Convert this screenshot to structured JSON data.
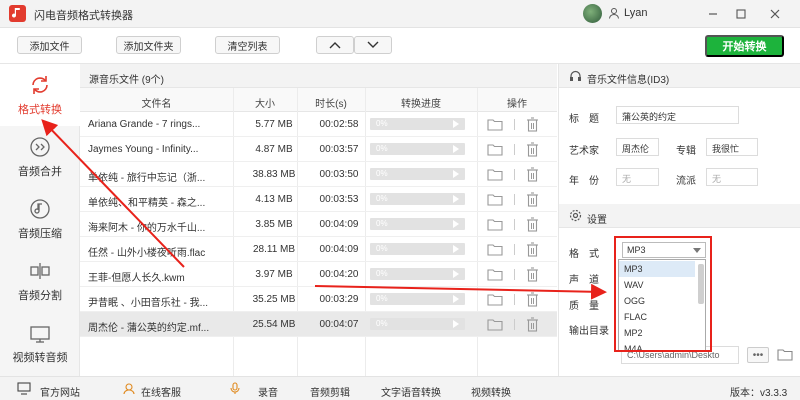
{
  "window": {
    "title": "闪电音频格式转换器",
    "user": "Lyan"
  },
  "toolbar": {
    "add_file": "添加文件",
    "add_folder": "添加文件夹",
    "clear_list": "清空列表",
    "start": "开始转换"
  },
  "sidebar": {
    "items": [
      {
        "label": "格式转换",
        "icon": "refresh-icon",
        "active": true
      },
      {
        "label": "音频合并",
        "icon": "merge-icon"
      },
      {
        "label": "音频压缩",
        "icon": "compress-icon"
      },
      {
        "label": "音频分割",
        "icon": "split-icon"
      },
      {
        "label": "视频转音频",
        "icon": "video-icon"
      }
    ]
  },
  "list": {
    "title": "源音乐文件 (9个)",
    "columns": {
      "name": "文件名",
      "size": "大小",
      "duration": "时长(s)",
      "progress": "转换进度",
      "action": "操作"
    },
    "progress_label": "0%",
    "rows": [
      {
        "name": "Ariana Grande - 7 rings...",
        "size": "5.77 MB",
        "duration": "00:02:58"
      },
      {
        "name": "Jaymes Young - Infinity...",
        "size": "4.87 MB",
        "duration": "00:03:57"
      },
      {
        "name": "单依纯 - 旅行中忘记（浙...",
        "size": "38.83 MB",
        "duration": "00:03:50"
      },
      {
        "name": "单依纯、和平精英 - 森之...",
        "size": "4.13 MB",
        "duration": "00:03:53"
      },
      {
        "name": "海来阿木 - 你的万水千山...",
        "size": "3.85 MB",
        "duration": "00:04:09"
      },
      {
        "name": "任然 - 山外小楼夜听雨.flac",
        "size": "28.11 MB",
        "duration": "00:04:09"
      },
      {
        "name": "王菲-但愿人长久.kwm",
        "size": "3.97 MB",
        "duration": "00:04:20"
      },
      {
        "name": "尹昔眠 、小田音乐社 - 我...",
        "size": "35.25 MB",
        "duration": "00:03:29"
      },
      {
        "name": "周杰伦 - 蒲公英的约定.mf...",
        "size": "25.54 MB",
        "duration": "00:04:07",
        "selected": true
      }
    ]
  },
  "info": {
    "section_title": "音乐文件信息(ID3)",
    "title_label": "标　题",
    "title_value": "蒲公英的约定",
    "artist_label": "艺术家",
    "artist_value": "周杰伦",
    "album_label": "专辑",
    "album_value": "我很忙",
    "year_label": "年　份",
    "year_value": "无",
    "genre_label": "流派",
    "genre_value": "无"
  },
  "settings": {
    "section_title": "设置",
    "format_label": "格　式",
    "format_value": "MP3",
    "channel_label": "声　道",
    "quality_label": "质　量",
    "output_label": "输出目录",
    "output_path": "C:\\Users\\admin\\Deskto",
    "more_label": "•••",
    "format_options": [
      "MP3",
      "WAV",
      "OGG",
      "FLAC",
      "MP2",
      "M4A"
    ]
  },
  "statusbar": {
    "website": "官方网站",
    "support": "在线客服",
    "record": "录音",
    "audio_cut": "音频剪辑",
    "tts": "文字语音转换",
    "video_convert": "视频转换",
    "version": "版本：v3.3.3"
  },
  "colors": {
    "accent": "#e23b2e",
    "start": "#1db33c",
    "annotation": "#e8221b"
  }
}
